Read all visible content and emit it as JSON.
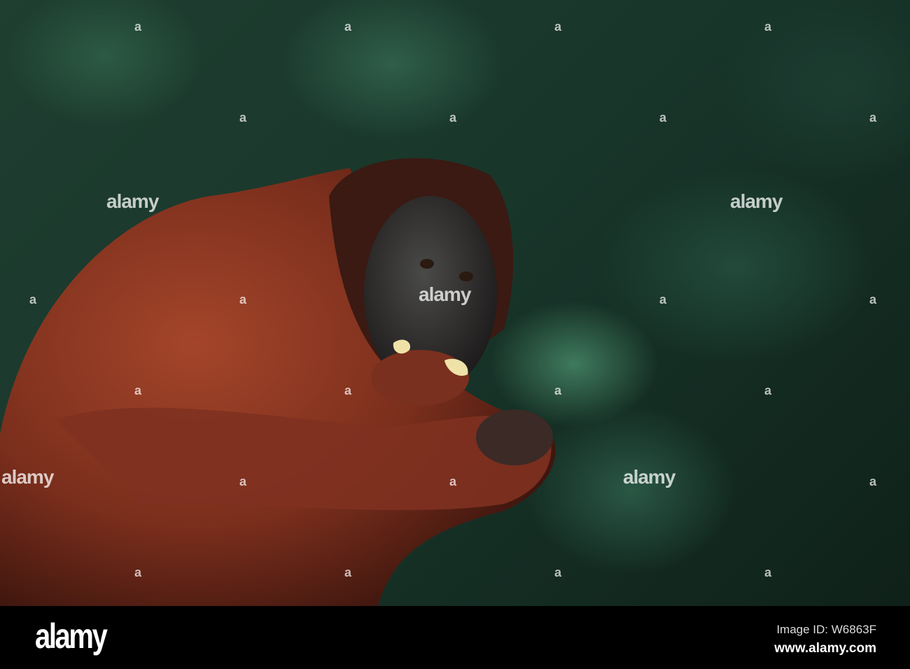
{
  "watermark": {
    "text": "alamy",
    "mark": "a"
  },
  "footer": {
    "logo": "alamy",
    "image_id": "Image ID: W6863F",
    "url": "www.alamy.com"
  }
}
